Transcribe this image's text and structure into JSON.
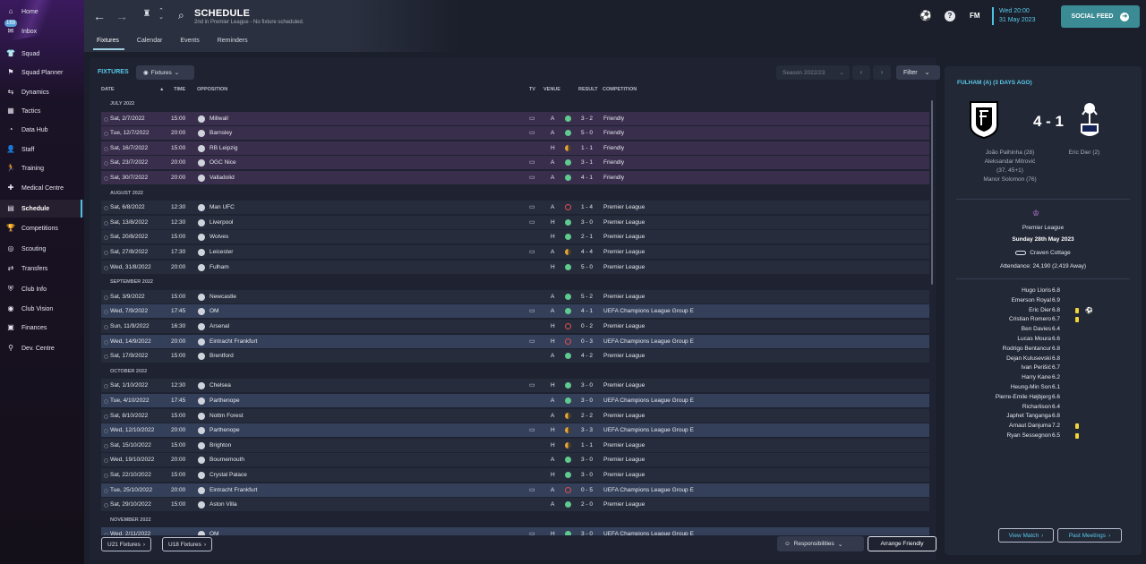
{
  "sidebar": {
    "items": [
      {
        "label": "Home",
        "icon": "home-icon",
        "glyph": "⌂",
        "active": false
      },
      {
        "label": "Inbox",
        "icon": "inbox-icon",
        "glyph": "✉",
        "active": false,
        "badge": "169"
      },
      {
        "label": "Squad",
        "icon": "squad-icon",
        "glyph": "👕",
        "active": false
      },
      {
        "label": "Squad Planner",
        "icon": "squad-planner-icon",
        "glyph": "⚑",
        "active": false
      },
      {
        "label": "Dynamics",
        "icon": "dynamics-icon",
        "glyph": "⇆",
        "active": false
      },
      {
        "label": "Tactics",
        "icon": "tactics-icon",
        "glyph": "▦",
        "active": false
      },
      {
        "label": "Data Hub",
        "icon": "data-hub-icon",
        "glyph": "◔",
        "active": false
      },
      {
        "label": "Staff",
        "icon": "staff-icon",
        "glyph": "👤",
        "active": false
      },
      {
        "label": "Training",
        "icon": "training-icon",
        "glyph": "🏃",
        "active": false
      },
      {
        "label": "Medical Centre",
        "icon": "medical-icon",
        "glyph": "✚",
        "active": false
      },
      {
        "label": "Schedule",
        "icon": "schedule-icon",
        "glyph": "▤",
        "active": true
      },
      {
        "label": "Competitions",
        "icon": "competitions-icon",
        "glyph": "🏆",
        "active": false
      },
      {
        "label": "Scouting",
        "icon": "scouting-icon",
        "glyph": "◎",
        "active": false
      },
      {
        "label": "Transfers",
        "icon": "transfers-icon",
        "glyph": "⇄",
        "active": false
      },
      {
        "label": "Club Info",
        "icon": "club-info-icon",
        "glyph": "⛨",
        "active": false
      },
      {
        "label": "Club Vision",
        "icon": "club-vision-icon",
        "glyph": "◉",
        "active": false
      },
      {
        "label": "Finances",
        "icon": "finances-icon",
        "glyph": "▣",
        "active": false
      },
      {
        "label": "Dev. Centre",
        "icon": "dev-centre-icon",
        "glyph": "⚲",
        "active": false
      }
    ]
  },
  "header": {
    "title": "SCHEDULE",
    "subtitle": "2nd in Premier League - No fixture scheduled.",
    "tabs": [
      "Fixtures",
      "Calendar",
      "Events",
      "Reminders"
    ],
    "fm": "FM",
    "date_time": "Wed 20:00",
    "date": "31 May 2023",
    "social_feed": "SOCIAL FEED"
  },
  "fixtures": {
    "heading": "FIXTURES",
    "view_dropdown": "Fixtures",
    "season": "Season 2022/23",
    "filter": "Filter",
    "columns": {
      "date": "DATE",
      "time": "TIME",
      "opposition": "OPPOSITION",
      "tv": "TV",
      "venue": "VENUE",
      "result": "RESULT",
      "competition": "COMPETITION"
    },
    "rows": [
      {
        "section": "JULY 2022"
      },
      {
        "date": "Sat, 2/7/2022",
        "time": "15:00",
        "opp": "Millwall",
        "tv": true,
        "venue": "A",
        "res": "w",
        "score": "3 - 2",
        "comp": "Friendly",
        "kind": "friendly"
      },
      {
        "date": "Tue, 12/7/2022",
        "time": "20:00",
        "opp": "Barnsley",
        "tv": true,
        "venue": "A",
        "res": "w",
        "score": "5 - 0",
        "comp": "Friendly",
        "kind": "friendly"
      },
      {
        "date": "Sat, 16/7/2022",
        "time": "15:00",
        "opp": "RB Leipzig",
        "tv": false,
        "venue": "H",
        "res": "d",
        "score": "1 - 1",
        "comp": "Friendly",
        "kind": "friendly"
      },
      {
        "date": "Sat, 23/7/2022",
        "time": "20:00",
        "opp": "OGC Nice",
        "tv": true,
        "venue": "A",
        "res": "w",
        "score": "3 - 1",
        "comp": "Friendly",
        "kind": "friendly"
      },
      {
        "date": "Sat, 30/7/2022",
        "time": "20:00",
        "opp": "Valladolid",
        "tv": true,
        "venue": "A",
        "res": "w",
        "score": "4 - 1",
        "comp": "Friendly",
        "kind": "friendly"
      },
      {
        "section": "AUGUST 2022"
      },
      {
        "date": "Sat, 6/8/2022",
        "time": "12:30",
        "opp": "Man UFC",
        "tv": true,
        "venue": "A",
        "res": "l",
        "score": "1 - 4",
        "comp": "Premier League",
        "kind": "league"
      },
      {
        "date": "Sat, 13/8/2022",
        "time": "12:30",
        "opp": "Liverpool",
        "tv": true,
        "venue": "H",
        "res": "w",
        "score": "3 - 0",
        "comp": "Premier League",
        "kind": "league"
      },
      {
        "date": "Sat, 20/8/2022",
        "time": "15:00",
        "opp": "Wolves",
        "tv": false,
        "venue": "H",
        "res": "w",
        "score": "2 - 1",
        "comp": "Premier League",
        "kind": "league"
      },
      {
        "date": "Sat, 27/8/2022",
        "time": "17:30",
        "opp": "Leicester",
        "tv": true,
        "venue": "A",
        "res": "d",
        "score": "4 - 4",
        "comp": "Premier League",
        "kind": "league"
      },
      {
        "date": "Wed, 31/8/2022",
        "time": "20:00",
        "opp": "Fulham",
        "tv": false,
        "venue": "H",
        "res": "w",
        "score": "5 - 0",
        "comp": "Premier League",
        "kind": "league"
      },
      {
        "section": "SEPTEMBER 2022"
      },
      {
        "date": "Sat, 3/9/2022",
        "time": "15:00",
        "opp": "Newcastle",
        "tv": false,
        "venue": "A",
        "res": "w",
        "score": "5 - 2",
        "comp": "Premier League",
        "kind": "league"
      },
      {
        "date": "Wed, 7/9/2022",
        "time": "17:45",
        "opp": "OM",
        "tv": true,
        "venue": "A",
        "res": "w",
        "score": "4 - 1",
        "comp": "UEFA Champions League Group E",
        "kind": "ucl"
      },
      {
        "date": "Sun, 11/9/2022",
        "time": "16:30",
        "opp": "Arsenal",
        "tv": false,
        "venue": "H",
        "res": "l",
        "score": "0 - 2",
        "comp": "Premier League",
        "kind": "league"
      },
      {
        "date": "Wed, 14/9/2022",
        "time": "20:00",
        "opp": "Eintracht Frankfurt",
        "tv": true,
        "venue": "H",
        "res": "l",
        "score": "0 - 3",
        "comp": "UEFA Champions League Group E",
        "kind": "ucl"
      },
      {
        "date": "Sat, 17/9/2022",
        "time": "15:00",
        "opp": "Brentford",
        "tv": false,
        "venue": "A",
        "res": "w",
        "score": "4 - 2",
        "comp": "Premier League",
        "kind": "league"
      },
      {
        "section": "OCTOBER 2022"
      },
      {
        "date": "Sat, 1/10/2022",
        "time": "12:30",
        "opp": "Chelsea",
        "tv": true,
        "venue": "H",
        "res": "w",
        "score": "3 - 0",
        "comp": "Premier League",
        "kind": "league"
      },
      {
        "date": "Tue, 4/10/2022",
        "time": "17:45",
        "opp": "Parthenope",
        "tv": false,
        "venue": "A",
        "res": "w",
        "score": "3 - 0",
        "comp": "UEFA Champions League Group E",
        "kind": "ucl"
      },
      {
        "date": "Sat, 8/10/2022",
        "time": "15:00",
        "opp": "Nottm Forest",
        "tv": false,
        "venue": "A",
        "res": "d",
        "score": "2 - 2",
        "comp": "Premier League",
        "kind": "league"
      },
      {
        "date": "Wed, 12/10/2022",
        "time": "20:00",
        "opp": "Parthenope",
        "tv": true,
        "venue": "H",
        "res": "d",
        "score": "3 - 3",
        "comp": "UEFA Champions League Group E",
        "kind": "ucl"
      },
      {
        "date": "Sat, 15/10/2022",
        "time": "15:00",
        "opp": "Brighton",
        "tv": false,
        "venue": "H",
        "res": "d",
        "score": "1 - 1",
        "comp": "Premier League",
        "kind": "league"
      },
      {
        "date": "Wed, 19/10/2022",
        "time": "20:00",
        "opp": "Bournemouth",
        "tv": false,
        "venue": "A",
        "res": "w",
        "score": "3 - 0",
        "comp": "Premier League",
        "kind": "league"
      },
      {
        "date": "Sat, 22/10/2022",
        "time": "15:00",
        "opp": "Crystal Palace",
        "tv": false,
        "venue": "H",
        "res": "w",
        "score": "3 - 0",
        "comp": "Premier League",
        "kind": "league"
      },
      {
        "date": "Tue, 25/10/2022",
        "time": "20:00",
        "opp": "Eintracht Frankfurt",
        "tv": true,
        "venue": "A",
        "res": "l",
        "score": "0 - 5",
        "comp": "UEFA Champions League Group E",
        "kind": "ucl"
      },
      {
        "date": "Sat, 29/10/2022",
        "time": "15:00",
        "opp": "Aston Villa",
        "tv": false,
        "venue": "A",
        "res": "w",
        "score": "2 - 0",
        "comp": "Premier League",
        "kind": "league"
      },
      {
        "section": "NOVEMBER 2022"
      },
      {
        "date": "Wed, 2/11/2022",
        "time": "",
        "opp": "OM",
        "tv": true,
        "venue": "H",
        "res": "w",
        "score": "3 - 0",
        "comp": "UEFA Champions League Group E",
        "kind": "ucl"
      }
    ],
    "u21": "U21 Fixtures",
    "u18": "U18 Fixtures",
    "responsibilities": "Responsibilities",
    "arrange": "Arrange Friendly"
  },
  "match": {
    "title": "FULHAM (A) (3 DAYS AGO)",
    "score": "4 - 1",
    "home_scorers": [
      "João Palhinha (28)",
      "Aleksandar Mitrović",
      "(37, 45+1)",
      "Manor Solomon (76)"
    ],
    "away_scorers": [
      "Eric Dier (2)"
    ],
    "competition": "Premier League",
    "date": "Sunday 28th May 2023",
    "stadium": "Craven Cottage",
    "attendance": "Attendance: 24,190 (2,419 Away)",
    "players": [
      {
        "name": "Hugo Lloris",
        "rating": "6.8",
        "card": false,
        "motm": false
      },
      {
        "name": "Emerson Royal",
        "rating": "6.9",
        "card": false,
        "motm": false
      },
      {
        "name": "Eric Dier",
        "rating": "6.8",
        "card": true,
        "motm": true
      },
      {
        "name": "Cristian Romero",
        "rating": "6.7",
        "card": true,
        "motm": false
      },
      {
        "name": "Ben Davies",
        "rating": "6.4",
        "card": false,
        "motm": false
      },
      {
        "name": "Lucas Moura",
        "rating": "6.6",
        "card": false,
        "motm": false
      },
      {
        "name": "Rodrigo Bentancur",
        "rating": "6.8",
        "card": false,
        "motm": false
      },
      {
        "name": "Dejan Kulusevski",
        "rating": "6.8",
        "card": false,
        "motm": false
      },
      {
        "name": "Ivan Perišić",
        "rating": "6.7",
        "card": false,
        "motm": false
      },
      {
        "name": "Harry Kane",
        "rating": "6.2",
        "card": false,
        "motm": false
      },
      {
        "name": "Heung-Min Son",
        "rating": "6.1",
        "card": false,
        "motm": false
      },
      {
        "name": "Pierre-Emile Højbjerg",
        "rating": "6.6",
        "card": false,
        "motm": false
      },
      {
        "name": "Richarlison",
        "rating": "6.4",
        "card": false,
        "motm": false
      },
      {
        "name": "Japhet Tanganga",
        "rating": "6.8",
        "card": false,
        "motm": false
      },
      {
        "name": "Arnaut Danjuma",
        "rating": "7.2",
        "card": true,
        "motm": false
      },
      {
        "name": "Ryan Sessegnon",
        "rating": "6.5",
        "card": true,
        "motm": false
      }
    ],
    "view_match": "View Match",
    "past_meetings": "Past Meetings"
  },
  "colors": {
    "accent": "#58c9e8",
    "win": "#5fca8e",
    "draw": "#e4a53a",
    "loss": "#e04d4d",
    "friendly_row": "#3a2e4d",
    "ucl_row": "#34405a"
  }
}
